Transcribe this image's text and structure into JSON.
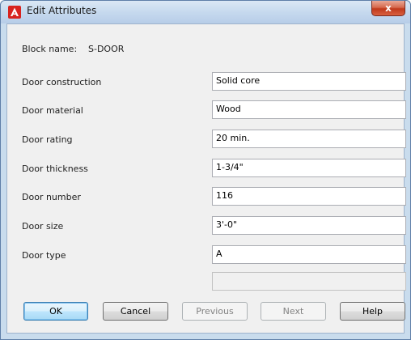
{
  "window": {
    "title": "Edit Attributes",
    "close_glyph": "x"
  },
  "block": {
    "label": "Block name:",
    "value": "S-DOOR"
  },
  "attributes": [
    {
      "label": "Door construction",
      "value": "Solid core"
    },
    {
      "label": "Door material",
      "value": "Wood"
    },
    {
      "label": "Door rating",
      "value": "20 min."
    },
    {
      "label": "Door thickness",
      "value": "1-3/4\""
    },
    {
      "label": "Door number",
      "value": "116"
    },
    {
      "label": "Door size",
      "value": "3'-0\""
    },
    {
      "label": "Door type",
      "value": "A"
    }
  ],
  "extra_field": {
    "value": ""
  },
  "buttons": {
    "ok": "OK",
    "cancel": "Cancel",
    "previous": "Previous",
    "next": "Next",
    "help": "Help"
  },
  "colors": {
    "app_icon": "#d8231f",
    "accent": "#3c7fb1"
  },
  "icons": {
    "app": "autocad-logo-icon",
    "close": "close-icon"
  }
}
